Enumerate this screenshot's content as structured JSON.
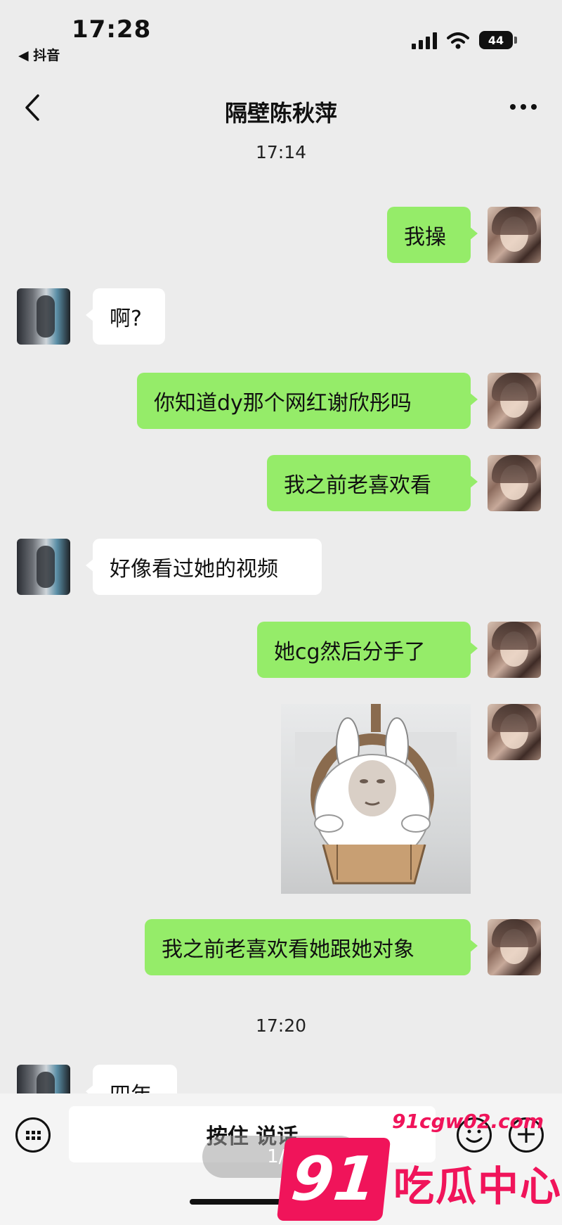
{
  "status_bar": {
    "time": "17:28",
    "back_app": "◀ 抖音",
    "battery": "44"
  },
  "nav": {
    "title": "隔壁陈秋萍"
  },
  "timestamps": [
    "17:14",
    "17:20"
  ],
  "messages": [
    {
      "sender": "me",
      "text": "我操"
    },
    {
      "sender": "other",
      "text": "啊?"
    },
    {
      "sender": "me",
      "text": "你知道dy那个网红谢欣彤吗"
    },
    {
      "sender": "me",
      "text": "我之前老喜欢看"
    },
    {
      "sender": "other",
      "text": "好像看过她的视频"
    },
    {
      "sender": "me",
      "text": "她cg然后分手了"
    },
    {
      "sender": "me",
      "type": "sticker",
      "icon": "rabbit-hanging-swing-sticker"
    },
    {
      "sender": "me",
      "text": "我之前老喜欢看她跟她对象"
    },
    {
      "sender": "other",
      "text": "四年"
    }
  ],
  "input_bar": {
    "hold_to_talk": "按住 说话",
    "pager": "1/3"
  },
  "watermark": {
    "number": "91",
    "url": "91cgw02.com",
    "name": "吃瓜中心",
    "color": "#f0145a"
  },
  "colors": {
    "bubble_me": "#95ec69",
    "bubble_other": "#ffffff",
    "background": "#ececec"
  }
}
